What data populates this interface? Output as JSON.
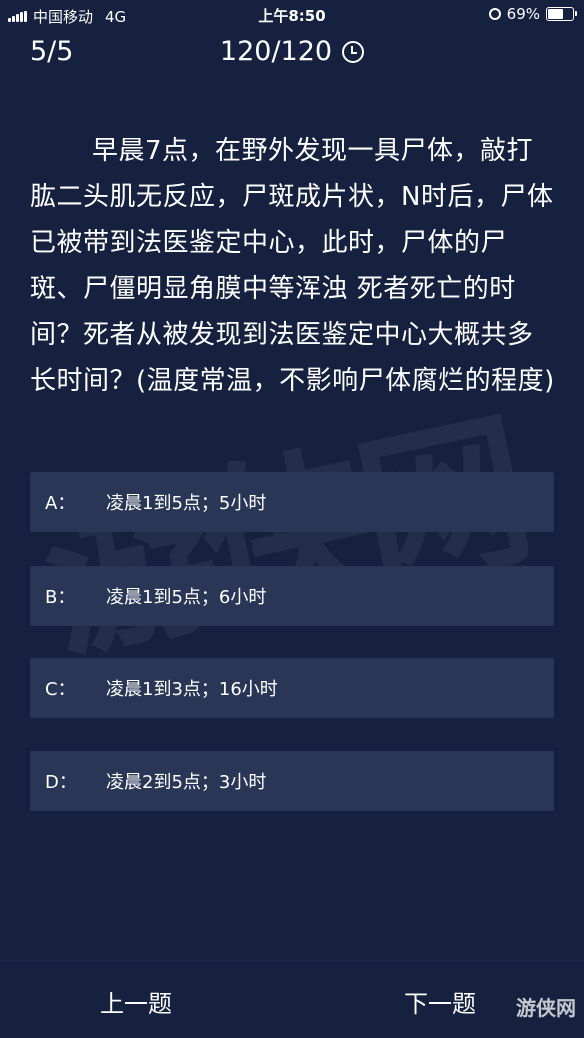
{
  "status": {
    "carrier": "中国移动",
    "network": "4G",
    "time": "上午8:50",
    "battery": "69%",
    "battery_level": 0.69
  },
  "header": {
    "progress": "5/5",
    "score": "120/120"
  },
  "question": {
    "text": "早晨7点，在野外发现一具尸体，敲打肱二头肌无反应，尸斑成片状，N时后，尸体已被带到法医鉴定中心，此时，尸体的尸斑、尸僵明显角膜中等浑浊 死者死亡的时间？死者从被发现到法医鉴定中心大概共多长时间？(温度常温，不影响尸体腐烂的程度)"
  },
  "options": [
    {
      "key": "A：",
      "text": "凌晨1到5点；5小时"
    },
    {
      "key": "B：",
      "text": "凌晨1到5点；6小时"
    },
    {
      "key": "C：",
      "text": "凌晨1到3点；16小时"
    },
    {
      "key": "D：",
      "text": "凌晨2到5点；3小时"
    }
  ],
  "footer": {
    "prev_label": "上一题",
    "next_label": "下一题"
  },
  "watermark": "游侠网",
  "corner_logo": "游侠网"
}
